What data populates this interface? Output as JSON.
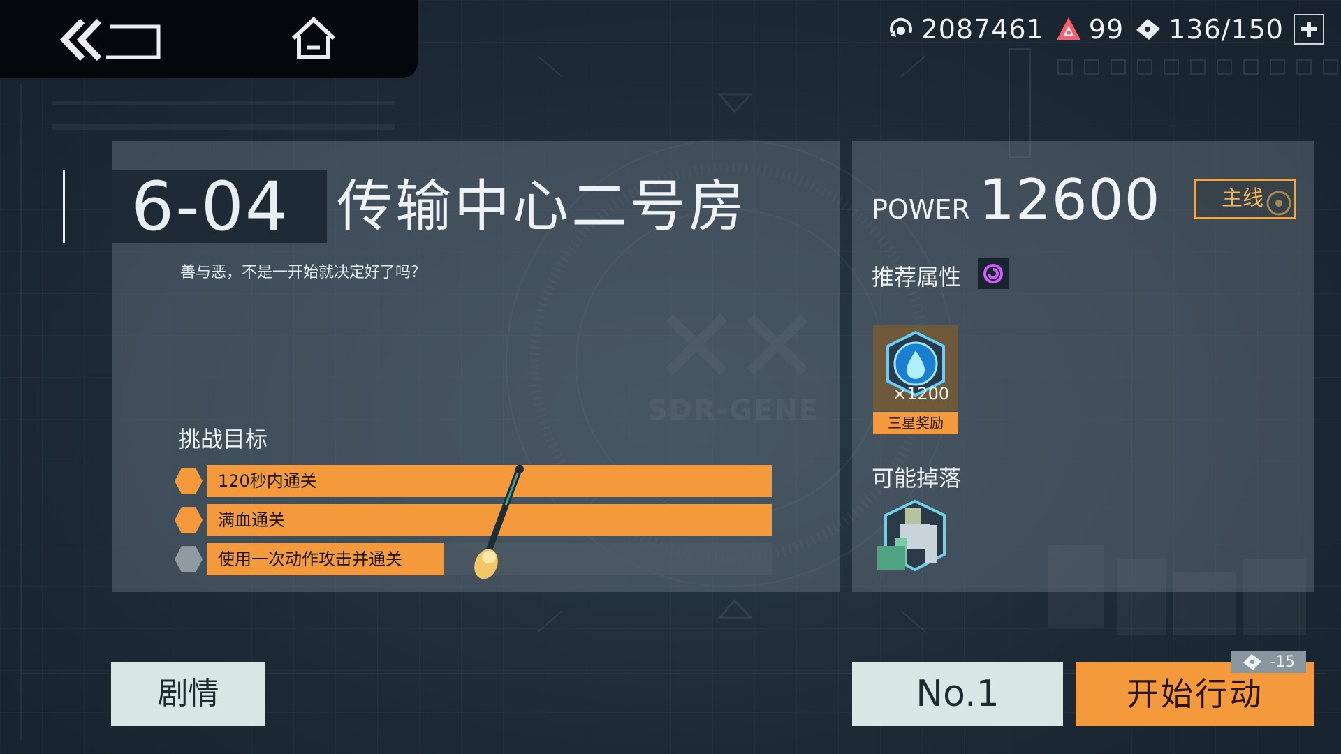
{
  "nav": {
    "back_icon": "double-chevron-back-icon",
    "home_icon": "home-icon"
  },
  "currency": {
    "coins": {
      "icon": "coin-ring-icon",
      "value": "2087461"
    },
    "crystals": {
      "icon": "red-triangle-crystal-icon",
      "value": "99"
    },
    "stamina": {
      "icon": "ticket-icon",
      "value": "136/150"
    },
    "add_icon": "plus-icon"
  },
  "stage": {
    "code": "6-04",
    "name": "传输中心二号房",
    "description": "善与恶，不是一开始就决定好了吗？"
  },
  "objectives": {
    "title": "挑战目标",
    "items": [
      {
        "label": "120秒内通关",
        "completed": true,
        "progress": 1.0
      },
      {
        "label": "满血通关",
        "completed": true,
        "progress": 1.0
      },
      {
        "label": "使用一次动作攻击并通关",
        "completed": false,
        "progress": 0.42
      }
    ]
  },
  "info": {
    "power_label": "POWER",
    "power_value": "12600",
    "mainline_tag": "主线",
    "recommended_attr_label": "推荐属性",
    "recommended_attr_icon": "purple-swirl-icon",
    "reward": {
      "icon": "blue-water-drop-gem-icon",
      "quantity": "×1200",
      "badge": "三星奖励"
    },
    "possible_drops_label": "可能掉落",
    "drop_item_icon": "mech-robot-icon"
  },
  "buttons": {
    "plot": "剧情",
    "rank": "No.1",
    "start": "开始行动",
    "cost": "-15",
    "cost_icon": "ticket-icon"
  },
  "colors": {
    "accent": "#f59a3c",
    "panel": "#5b6a76",
    "button_light": "#d9e7e4",
    "background": "#1c2a36"
  }
}
